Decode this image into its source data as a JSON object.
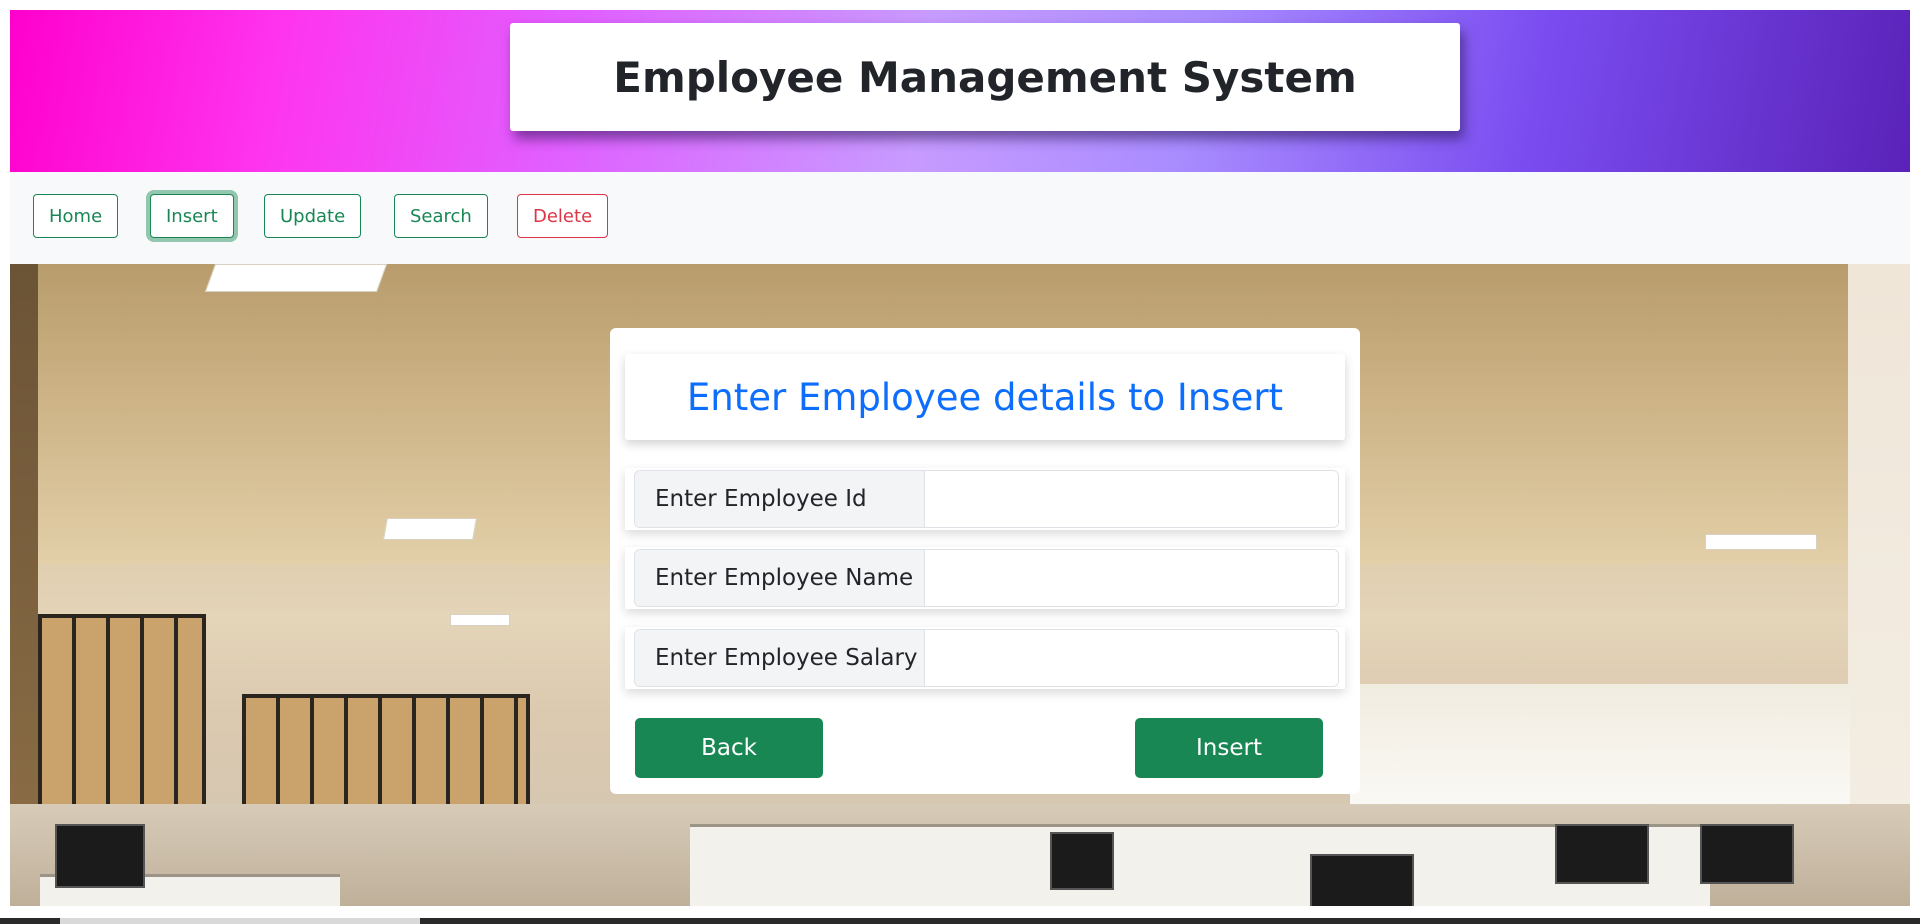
{
  "header": {
    "title": "Employee Management System"
  },
  "nav": {
    "items": [
      {
        "label": "Home",
        "variant": "success"
      },
      {
        "label": "Insert",
        "variant": "success",
        "active": true
      },
      {
        "label": "Update",
        "variant": "success"
      },
      {
        "label": "Search",
        "variant": "success"
      },
      {
        "label": "Delete",
        "variant": "danger"
      }
    ]
  },
  "form": {
    "heading": "Enter Employee details to Insert",
    "fields": [
      {
        "label": "Enter Employee Id",
        "value": ""
      },
      {
        "label": "Enter Employee Name",
        "value": ""
      },
      {
        "label": "Enter Employee Salary",
        "value": ""
      }
    ],
    "back_label": "Back",
    "submit_label": "Insert"
  },
  "colors": {
    "success": "#198754",
    "danger": "#dc3545",
    "primary": "#0d6efd",
    "heading_text": "#212529"
  },
  "icons": []
}
